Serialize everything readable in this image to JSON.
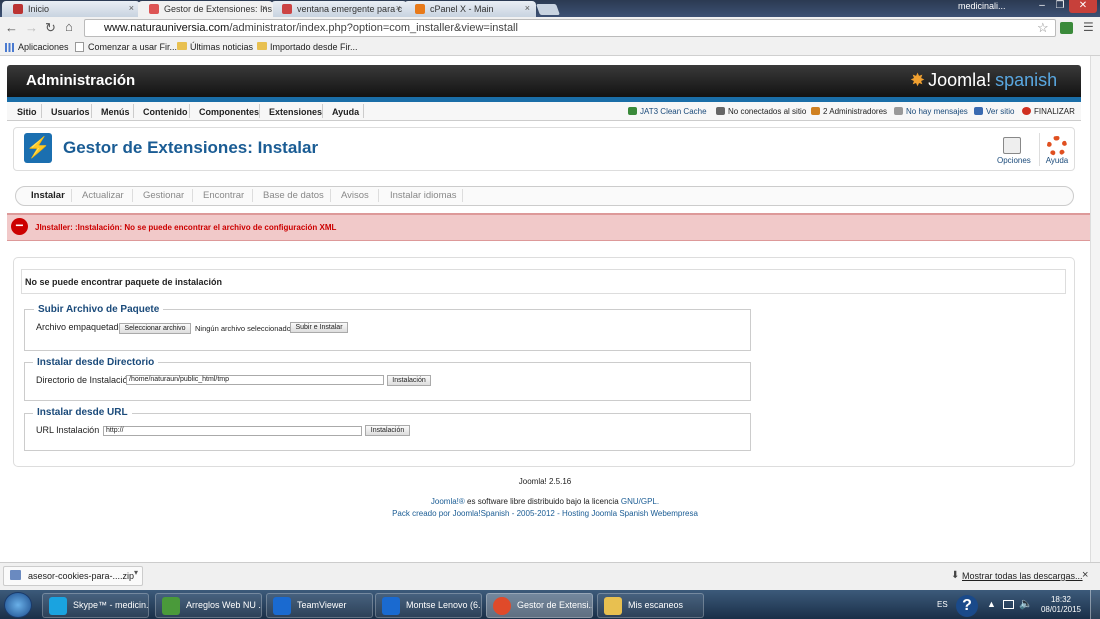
{
  "browser": {
    "tabs": [
      {
        "title": "Inicio",
        "active": false
      },
      {
        "title": "Gestor de Extensiones: Ins",
        "active": true
      },
      {
        "title": "ventana emergente para c",
        "active": false
      },
      {
        "title": "cPanel X - Main",
        "active": false
      }
    ],
    "tab_close": "×",
    "user": "medicinali...",
    "window_minimize": "–",
    "window_restore": "❐",
    "window_close": "✕",
    "url_host": "www.naturauniversia.com",
    "url_path": "/administrator/index.php?option=com_installer&view=install",
    "bookmarks": [
      {
        "label": "Aplicaciones",
        "icon": "apps-grid-icon"
      },
      {
        "label": "Comenzar a usar Fir...",
        "icon": "page-icon"
      },
      {
        "label": "Últimas noticias",
        "icon": "folder-icon"
      },
      {
        "label": "Importado desde Fir...",
        "icon": "folder-icon"
      }
    ]
  },
  "admin": {
    "title": "Administración",
    "logo_text": "Joomla!",
    "logo_sub": "spanish",
    "menu": [
      "Sitio",
      "Usuarios",
      "Menús",
      "Contenido",
      "Componentes",
      "Extensiones",
      "Ayuda"
    ],
    "status": {
      "cache": "JAT3 Clean Cache",
      "online_site": "No conectados al sitio",
      "admins": "2 Administradores",
      "messages": "No hay mensajes",
      "view_site": "Ver sitio",
      "logout": "FINALIZAR"
    },
    "page_title": "Gestor de Extensiones: Instalar",
    "toolbar": {
      "options": "Opciones",
      "help": "Ayuda"
    },
    "subtabs": [
      "Instalar",
      "Actualizar",
      "Gestionar",
      "Encontrar",
      "Base de datos",
      "Avisos",
      "Instalar idiomas"
    ],
    "active_subtab": "Instalar",
    "error_message": "JInstaller: :Instalación: No se puede encontrar el archivo de configuración XML",
    "no_package": "No se puede encontrar paquete de instalación",
    "upload": {
      "legend": "Subir Archivo de Paquete",
      "label": "Archivo empaquetado",
      "file_button": "Seleccionar archivo",
      "file_status": "Ningún archivo seleccionado",
      "submit": "Subir e Instalar"
    },
    "directory": {
      "legend": "Instalar desde Directorio",
      "label": "Directorio de Instalación",
      "value": "/home/naturaun/public_html/tmp",
      "submit": "Instalación"
    },
    "url": {
      "legend": "Instalar desde URL",
      "label": "URL Instalación",
      "value": "http://",
      "submit": "Instalación"
    },
    "footer": {
      "version": "Joomla! 2.5.16",
      "license_link": "Joomla!®",
      "license_text": " es software libre distribuido bajo la licencia ",
      "license_gpl": "GNU/GPL.",
      "pack": "Pack creado por Joomla!Spanish - 2005-2012 - Hosting Joomla Spanish Webempresa"
    }
  },
  "downloads": {
    "file": "asesor-cookies-para-....zip",
    "show_all": "Mostrar todas las descargas...",
    "close": "×"
  },
  "taskbar": {
    "items": [
      {
        "label": "Skype™ - medicin...",
        "color": "#1aa3e0",
        "active": false
      },
      {
        "label": "Arreglos Web NU ...",
        "color": "#4a9a3a",
        "active": false
      },
      {
        "label": "TeamViewer",
        "color": "#1a6ad0",
        "active": false
      },
      {
        "label": "Montse Lenovo (6...",
        "color": "#1a6ad0",
        "active": false
      },
      {
        "label": "Gestor de Extensi...",
        "color": "#e04a2a",
        "active": true
      },
      {
        "label": "Mis escaneos",
        "color": "#e8c050",
        "active": false
      }
    ],
    "lang": "ES",
    "time": "18:32",
    "date": "08/01/2015"
  }
}
